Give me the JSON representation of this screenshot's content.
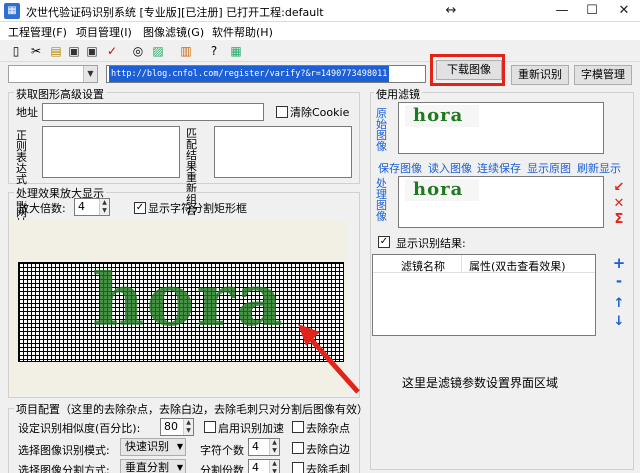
{
  "window": {
    "title": "次世代验证码识别系统 [专业版][已注册] 已打开工程:default",
    "icon_name": "app-logo-icon",
    "controls": [
      "↔",
      "—",
      "☐",
      "✕"
    ]
  },
  "menu": [
    "工程管理(F)",
    "项目管理(I)",
    "图像滤镜(G)",
    "软件帮助(H)"
  ],
  "toolbar_icons": [
    "new-file-icon",
    "cut-icon",
    "open-icon",
    "save-icon",
    "save-as-icon",
    "check-icon",
    "binoculars-icon",
    "image-icon",
    "books-icon",
    "help-icon",
    "image-frame-icon"
  ],
  "url_bar": {
    "combo_value": "",
    "url": "http://blog.cnfol.com/register/varify?&r=1490773498011",
    "download_button": "下载图像",
    "recognize_button": "重新识别",
    "charlib_button": "字模管理"
  },
  "advanced": {
    "title": "获取图形高级设置",
    "address_label": "地址",
    "address_value": "",
    "clear_cookie_label": "清除Cookie",
    "regex_label": "正则表达式匹配网址",
    "match_label": "匹配结果重新组合"
  },
  "zoom": {
    "title": "处理效果放大显示",
    "factor_label": "放大倍数:",
    "factor_value": "4",
    "show_rect_label": "显示字符分割矩形框",
    "captcha_text": "hora"
  },
  "project": {
    "title": "项目配置（这里的去除杂点，去除白边，去除毛刺只对分割后图像有效）",
    "similarity_label": "设定识别相似度(百分比):",
    "similarity_value": "80",
    "accel_label": "启用识别加速",
    "remove_noise_label": "去除杂点",
    "mode_label": "选择图像识别模式:",
    "mode_value": "快速识别",
    "char_count_label": "字符个数",
    "char_count_value": "4",
    "remove_border_label": "去除白边",
    "split_label": "选择图像分割方式:",
    "split_value": "垂直分割",
    "split_count_label": "分割份数",
    "split_count_value": "4",
    "remove_burr_label": "去除毛刺"
  },
  "filter": {
    "title": "使用滤镜",
    "original_label": "原始图像",
    "captcha_text": "hora",
    "links": [
      "保存图像",
      "读入图像",
      "连续保存",
      "显示原图",
      "刷新显示"
    ],
    "processed_label": "处理图像",
    "show_result_label": "显示识别结果:",
    "col_name": "滤镜名称",
    "col_attr": "属性(双击查看效果)",
    "side_icons": [
      "brush-icon",
      "close-icon",
      "sigma-icon"
    ],
    "list_icons": [
      "+",
      "-",
      "↑",
      "↓"
    ],
    "area_note": "这里是滤镜参数设置界面区域"
  },
  "colors": {
    "highlight": "#1c5fd6",
    "annotation": "#e2231a",
    "captcha_green": "#1f7a1f"
  }
}
